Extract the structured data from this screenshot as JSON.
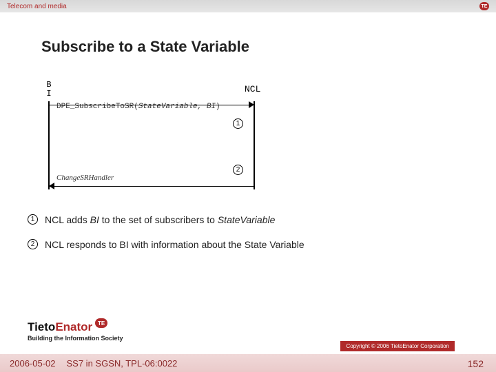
{
  "header": {
    "category": "Telecom and media",
    "badge": "TE"
  },
  "title": "Subscribe to a State Variable",
  "diagram": {
    "left_actor": "BI",
    "right_actor": "NCL",
    "msg1_prefix": "DPE_SubscribeToSR(",
    "msg1_args": "StateVariable, BI",
    "msg1_suffix": ")",
    "msg2": "ChangeSRHandler",
    "circ1": "1",
    "circ2": "2"
  },
  "notes": {
    "n1": {
      "num": "1",
      "pre": "NCL adds ",
      "i1": "BI",
      "mid": " to the set of subscribers to ",
      "i2": "StateVariable"
    },
    "n2": {
      "num": "2",
      "text": "NCL responds to BI with information about the State Variable"
    }
  },
  "logo": {
    "t": "Tieto",
    "e": "Enator",
    "badge": "TE",
    "tag": "Building the Information Society"
  },
  "footer": {
    "date": "2006-05-02",
    "doc": "SS7 in SGSN, TPL-06:0022",
    "page": "152"
  },
  "copyright": "Copyright © 2006 TietoEnator Corporation"
}
